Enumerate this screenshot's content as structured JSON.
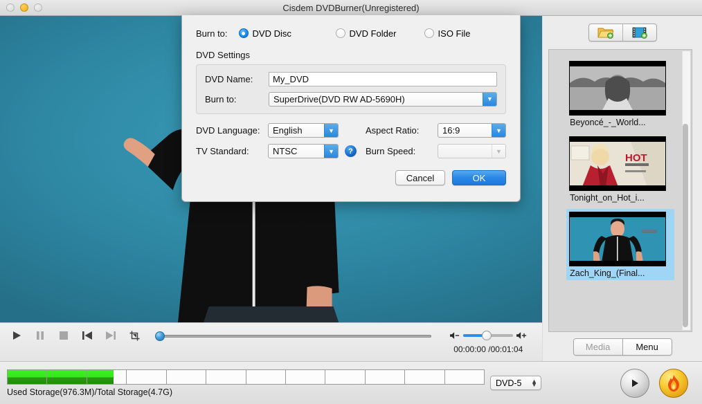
{
  "window": {
    "title": "Cisdem DVDBurner(Unregistered)",
    "traffic": {
      "close": "close-button",
      "minimize": "minimize-button",
      "zoom": "zoom-button"
    }
  },
  "toolbar": {
    "add_folder_label": "add-folder-icon",
    "add_video_label": "add-video-icon"
  },
  "media": {
    "items": [
      {
        "label": "Beyoncé_-_World...",
        "selected": false
      },
      {
        "label": "Tonight_on_Hot_i...",
        "selected": false
      },
      {
        "label": "Zach_King_(Final...",
        "selected": true
      }
    ],
    "tabs": [
      {
        "label": "Media",
        "active": false
      },
      {
        "label": "Menu",
        "active": true
      }
    ]
  },
  "player": {
    "controls": [
      "play",
      "pause",
      "stop",
      "previous",
      "next",
      "crop"
    ],
    "current_time": "00:00:00",
    "total_time": "00:01:04",
    "time_display": "00:00:00 /00:01:04",
    "volume_percent": 44,
    "seek_percent": 0
  },
  "storage": {
    "text": "Used Storage(976.3M)/Total Storage(4.7G)",
    "used": "976.3M",
    "total": "4.7G",
    "segments_total": 12,
    "segments_filled": 3,
    "partial_segment_percent": 68,
    "disc_type": "DVD-5",
    "fill_color": "#35e81d"
  },
  "actions": {
    "preview_label": "preview-button",
    "burn_label": "burn-button"
  },
  "dialog": {
    "burn_to_label": "Burn to:",
    "burn_targets": [
      {
        "label": "DVD Disc",
        "selected": true
      },
      {
        "label": "DVD Folder",
        "selected": false
      },
      {
        "label": "ISO File",
        "selected": false
      }
    ],
    "section_title": "DVD Settings",
    "dvd_name_label": "DVD Name:",
    "dvd_name_value": "My_DVD",
    "burn_to_drive_label": "Burn to:",
    "burn_to_drive_value": "SuperDrive(DVD RW AD-5690H)",
    "dvd_language_label": "DVD Language:",
    "dvd_language_value": "English",
    "tv_standard_label": "TV Standard:",
    "tv_standard_value": "NTSC",
    "aspect_ratio_label": "Aspect Ratio:",
    "aspect_ratio_value": "16:9",
    "burn_speed_label": "Burn Speed:",
    "burn_speed_value": "",
    "help_label": "?",
    "cancel_label": "Cancel",
    "ok_label": "OK",
    "accent_color": "#2a86e6"
  }
}
